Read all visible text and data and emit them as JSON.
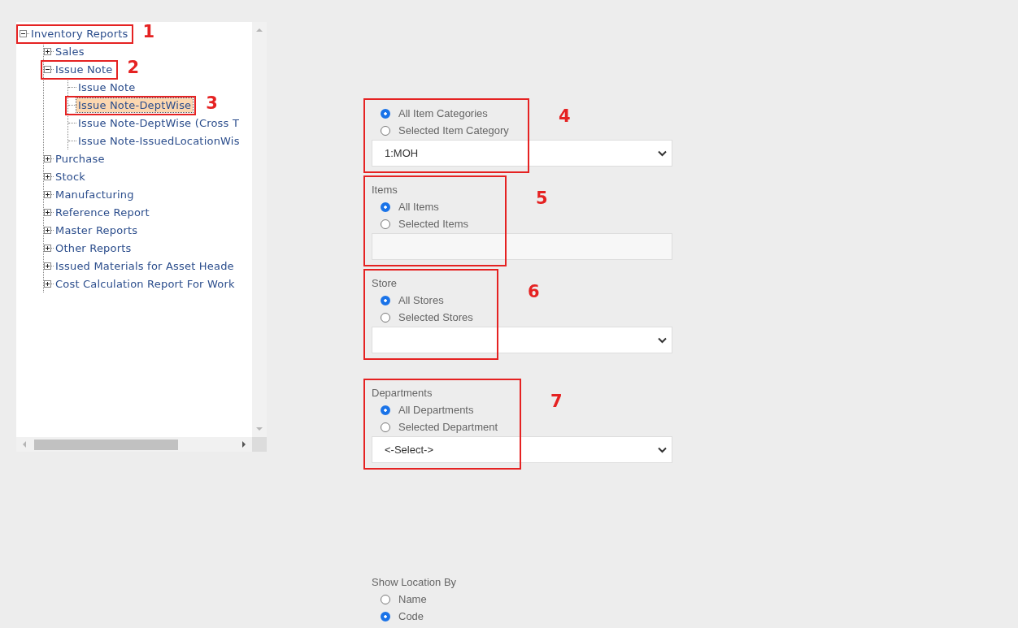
{
  "tree": {
    "items": [
      {
        "label": "Inventory Reports",
        "expanded": true,
        "selected": false,
        "annotation": "1",
        "children": [
          {
            "label": "Sales",
            "expanded": false,
            "selected": false
          },
          {
            "label": "Issue Note",
            "expanded": true,
            "selected": false,
            "annotation": "2",
            "children": [
              {
                "label": "Issue Note",
                "selected": false
              },
              {
                "label": "Issue Note-DeptWise",
                "selected": true,
                "annotation": "3"
              },
              {
                "label": "Issue Note-DeptWise (Cross T",
                "selected": false
              },
              {
                "label": "Issue Note-IssuedLocationWis",
                "selected": false
              }
            ]
          },
          {
            "label": "Purchase",
            "expanded": false,
            "selected": false
          },
          {
            "label": "Stock",
            "expanded": false,
            "selected": false
          },
          {
            "label": "Manufacturing",
            "expanded": false,
            "selected": false
          },
          {
            "label": "Reference Report",
            "expanded": false,
            "selected": false
          },
          {
            "label": "Master Reports",
            "expanded": false,
            "selected": false
          },
          {
            "label": "Other Reports",
            "expanded": false,
            "selected": false
          },
          {
            "label": "Issued Materials for Asset Heade",
            "expanded": false,
            "selected": false
          },
          {
            "label": "Cost Calculation Report For Work",
            "expanded": false,
            "selected": false
          }
        ]
      }
    ]
  },
  "form": {
    "sections": [
      {
        "annotation": "4",
        "options": [
          {
            "label": "All Item Categories",
            "selected": true
          },
          {
            "label": "Selected Item Category",
            "selected": false
          }
        ],
        "field": {
          "kind": "select",
          "value": "1:MOH"
        }
      },
      {
        "title": "Items",
        "annotation": "5",
        "options": [
          {
            "label": "All Items",
            "selected": true
          },
          {
            "label": "Selected Items",
            "selected": false
          }
        ],
        "field": {
          "kind": "text"
        }
      },
      {
        "title": "Store",
        "annotation": "6",
        "options": [
          {
            "label": "All Stores",
            "selected": true
          },
          {
            "label": "Selected Stores",
            "selected": false
          }
        ],
        "field": {
          "kind": "select"
        }
      },
      {
        "title": "Departments",
        "annotation": "7",
        "options": [
          {
            "label": "All Departments",
            "selected": true
          },
          {
            "label": "Selected Department",
            "selected": false
          }
        ],
        "field": {
          "kind": "select",
          "value": "<-Select->"
        }
      },
      {
        "title": "Show Location By",
        "options": [
          {
            "label": "Name",
            "selected": false
          },
          {
            "label": "Code",
            "selected": true
          }
        ]
      }
    ]
  }
}
